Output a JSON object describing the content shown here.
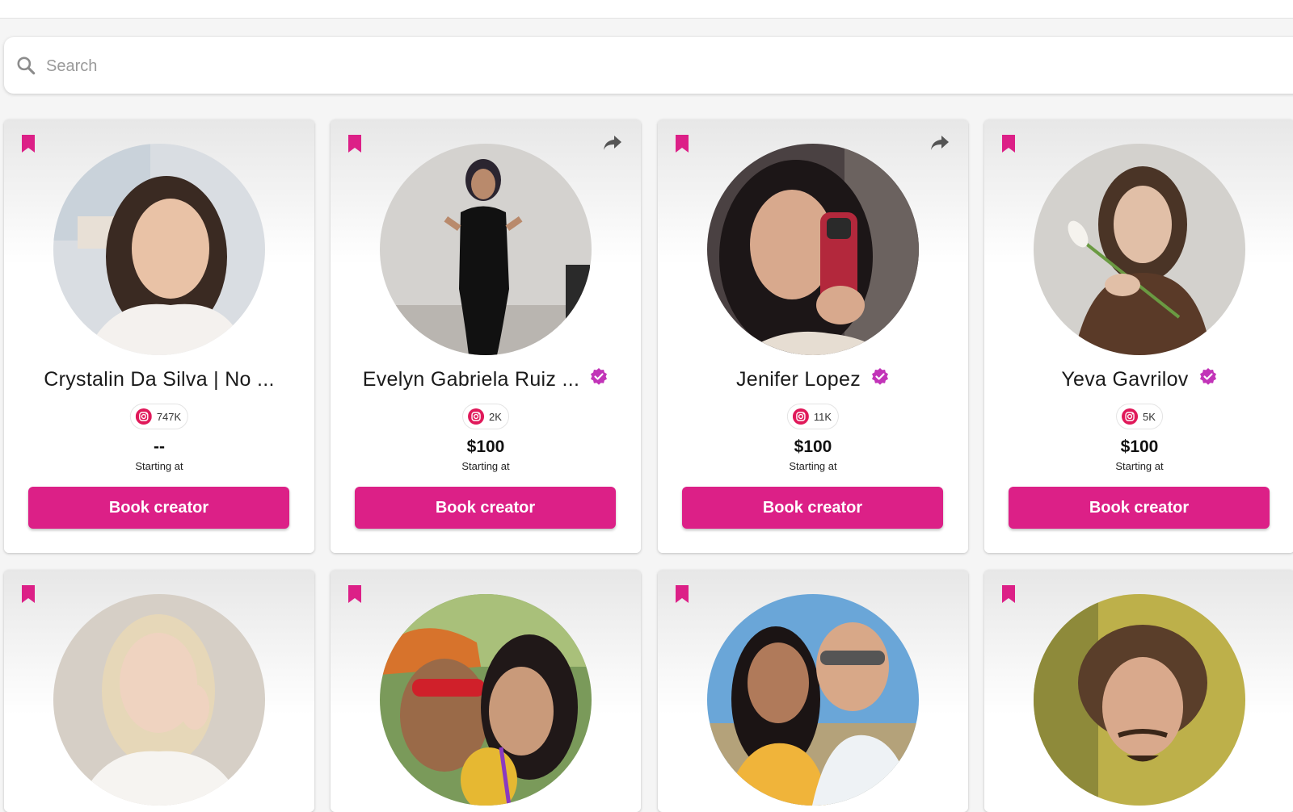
{
  "search": {
    "placeholder": "Search",
    "icon": "search-icon"
  },
  "colors": {
    "accent": "#dc2087",
    "verified": "#c234b8",
    "background": "#f5f5f5"
  },
  "cards": [
    {
      "name": "Crystalin Da Silva | No ...",
      "verified": false,
      "share": false,
      "platform": "instagram",
      "followers": "747K",
      "price": "--",
      "price_caption": "Starting at",
      "button_label": "Book creator"
    },
    {
      "name": "Evelyn Gabriela Ruiz ...",
      "verified": true,
      "share": true,
      "platform": "instagram",
      "followers": "2K",
      "price": "$100",
      "price_caption": "Starting at",
      "button_label": "Book creator"
    },
    {
      "name": "Jenifer Lopez",
      "verified": true,
      "share": true,
      "platform": "instagram",
      "followers": "11K",
      "price": "$100",
      "price_caption": "Starting at",
      "button_label": "Book creator"
    },
    {
      "name": "Yeva Gavrilov",
      "verified": true,
      "share": false,
      "platform": "instagram",
      "followers": "5K",
      "price": "$100",
      "price_caption": "Starting at",
      "button_label": "Book creator"
    }
  ],
  "row2_cards": [
    {},
    {},
    {},
    {}
  ]
}
